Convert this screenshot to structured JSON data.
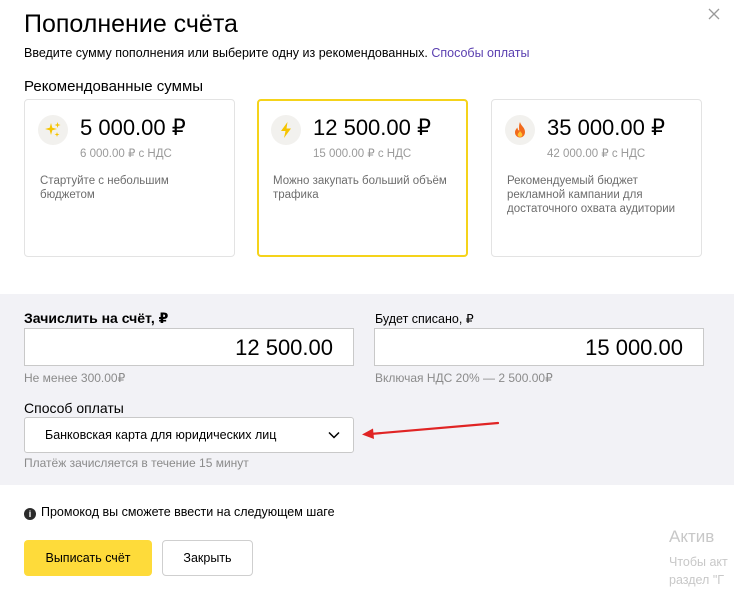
{
  "dialog": {
    "title": "Пополнение счёта",
    "subtitle": "Введите сумму пополнения или выберите одну из рекомендованных.",
    "payment_methods_link": "Способы оплаты"
  },
  "recommended": {
    "title": "Рекомендованные суммы",
    "cards": [
      {
        "icon": "sparkle-icon",
        "amount": "5 000.00 ₽",
        "vat": "6 000.00 ₽ с НДС",
        "description": "Стартуйте с небольшим бюджетом",
        "selected": false
      },
      {
        "icon": "lightning-icon",
        "amount": "12 500.00 ₽",
        "vat": "15 000.00 ₽ с НДС",
        "description": "Можно закупать больший объём трафика",
        "selected": true
      },
      {
        "icon": "fire-icon",
        "amount": "35 000.00 ₽",
        "vat": "42 000.00 ₽ с НДС",
        "description": "Рекомендуемый бюджет рекламной кампании для достаточного охвата аудитории",
        "selected": false
      }
    ]
  },
  "form": {
    "credit_label": "Зачислить на счёт, ₽",
    "credit_value": "12 500.00",
    "credit_hint": "Не менее 300.00₽",
    "debit_label": "Будет списано, ₽",
    "debit_value": "15 000.00",
    "debit_hint": "Включая НДС 20% — 2 500.00₽",
    "method_label": "Способ оплаты",
    "method_value": "Банковская карта для юридических лиц",
    "method_hint": "Платёж зачисляется в течение 15 минут"
  },
  "promo_note": "Промокод вы сможете ввести на следующем шаге",
  "buttons": {
    "primary": "Выписать счёт",
    "close": "Закрыть"
  },
  "watermark": {
    "line1": "Актив",
    "line2": "Чтобы акт",
    "line3": "раздел \"Г"
  },
  "colors": {
    "accent_yellow": "#fedb3a",
    "selected_border": "#f5d31a",
    "link": "#5a3fb0",
    "annotation_arrow": "#e02424"
  }
}
